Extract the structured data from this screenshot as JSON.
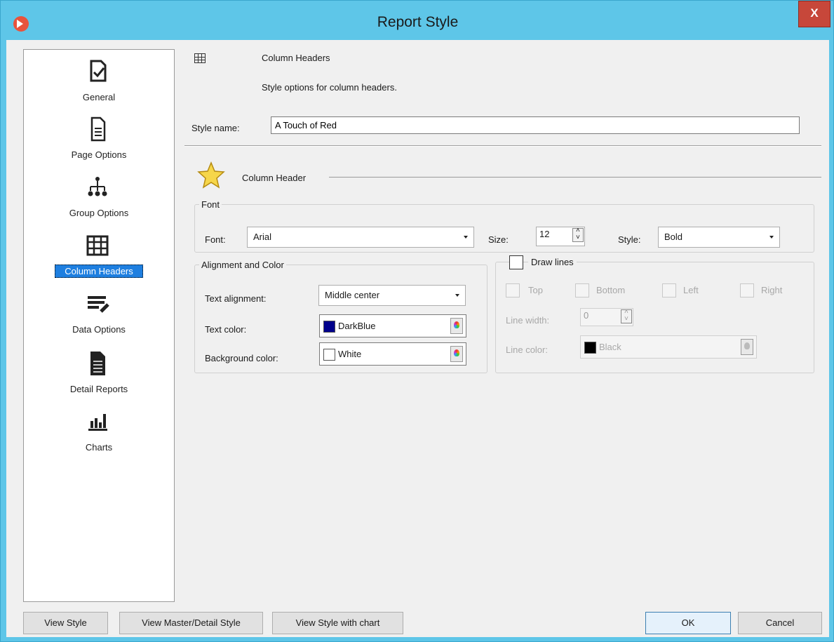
{
  "window": {
    "title": "Report Style",
    "close_label": "X"
  },
  "sidebar": {
    "items": [
      {
        "label": "General",
        "icon": "general-icon"
      },
      {
        "label": "Page Options",
        "icon": "page-icon"
      },
      {
        "label": "Group Options",
        "icon": "hierarchy-icon"
      },
      {
        "label": "Column Headers",
        "icon": "table-icon",
        "selected": true
      },
      {
        "label": "Data Options",
        "icon": "list-edit-icon"
      },
      {
        "label": "Detail Reports",
        "icon": "document-icon"
      },
      {
        "label": "Charts",
        "icon": "bar-chart-icon"
      }
    ]
  },
  "header": {
    "title": "Column Headers",
    "description": "Style options for column headers."
  },
  "style_name": {
    "label": "Style name:",
    "value": "A Touch of Red"
  },
  "section": {
    "title": "Column Header"
  },
  "font_group": {
    "legend": "Font",
    "font_label": "Font:",
    "font_value": "Arial",
    "size_label": "Size:",
    "size_value": "12",
    "style_label": "Style:",
    "style_value": "Bold"
  },
  "align_group": {
    "legend": "Alignment and Color",
    "text_align_label": "Text alignment:",
    "text_align_value": "Middle center",
    "text_color_label": "Text color:",
    "text_color_value": "DarkBlue",
    "text_color_hex": "#00008b",
    "bg_color_label": "Background color:",
    "bg_color_value": "White",
    "bg_color_hex": "#ffffff"
  },
  "lines_group": {
    "legend": "Draw lines",
    "checked": false,
    "top_label": "Top",
    "bottom_label": "Bottom",
    "left_label": "Left",
    "right_label": "Right",
    "line_width_label": "Line width:",
    "line_width_value": "0",
    "line_color_label": "Line color:",
    "line_color_value": "Black",
    "line_color_hex": "#000000"
  },
  "buttons": {
    "view_style": "View Style",
    "view_master_detail": "View Master/Detail Style",
    "view_with_chart": "View Style with chart",
    "ok": "OK",
    "cancel": "Cancel"
  }
}
